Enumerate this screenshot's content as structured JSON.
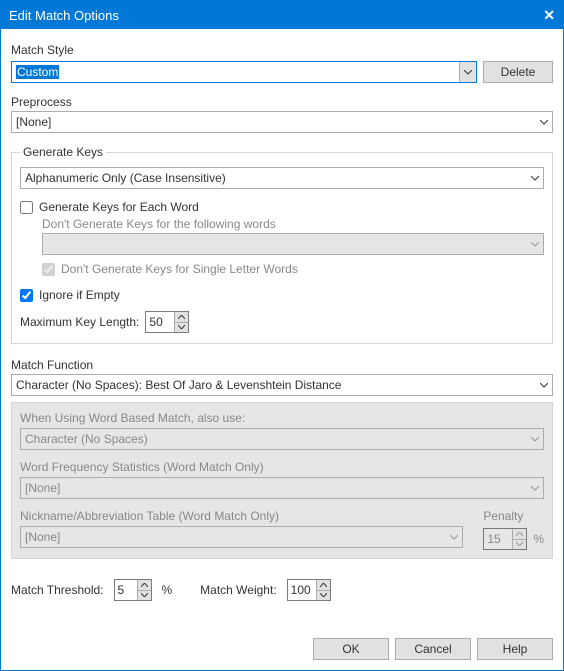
{
  "title": "Edit Match Options",
  "matchStyle": {
    "label": "Match Style",
    "value": "Custom",
    "deleteLabel": "Delete"
  },
  "preprocess": {
    "label": "Preprocess",
    "value": "[None]"
  },
  "generateKeys": {
    "legend": "Generate Keys",
    "value": "Alphanumeric Only (Case Insensitive)",
    "eachWord": {
      "label": "Generate Keys for Each Word",
      "checked": false,
      "subLabel": "Don't Generate Keys for the following words",
      "wordsValue": "",
      "singleLetterLabel": "Don't Generate Keys for Single Letter Words",
      "singleLetterChecked": true
    },
    "ignoreEmpty": {
      "label": "Ignore if Empty",
      "checked": true
    },
    "maxKeyLen": {
      "label": "Maximum Key Length:",
      "value": "50"
    }
  },
  "matchFunction": {
    "label": "Match Function",
    "value": "Character (No Spaces): Best Of Jaro & Levenshtein Distance",
    "wordBased": {
      "label": "When Using Word Based Match, also use:",
      "value": "Character (No Spaces)"
    },
    "freqStats": {
      "label": "Word Frequency Statistics (Word Match Only)",
      "value": "[None]"
    },
    "nickname": {
      "label": "Nickname/Abbreviation Table (Word Match Only)",
      "value": "[None]",
      "penaltyLabel": "Penalty",
      "penaltyValue": "15",
      "pctLabel": "%"
    }
  },
  "threshold": {
    "label": "Match Threshold:",
    "value": "5",
    "pctLabel": "%"
  },
  "weight": {
    "label": "Match Weight:",
    "value": "100"
  },
  "actions": {
    "ok": "OK",
    "cancel": "Cancel",
    "help": "Help"
  }
}
